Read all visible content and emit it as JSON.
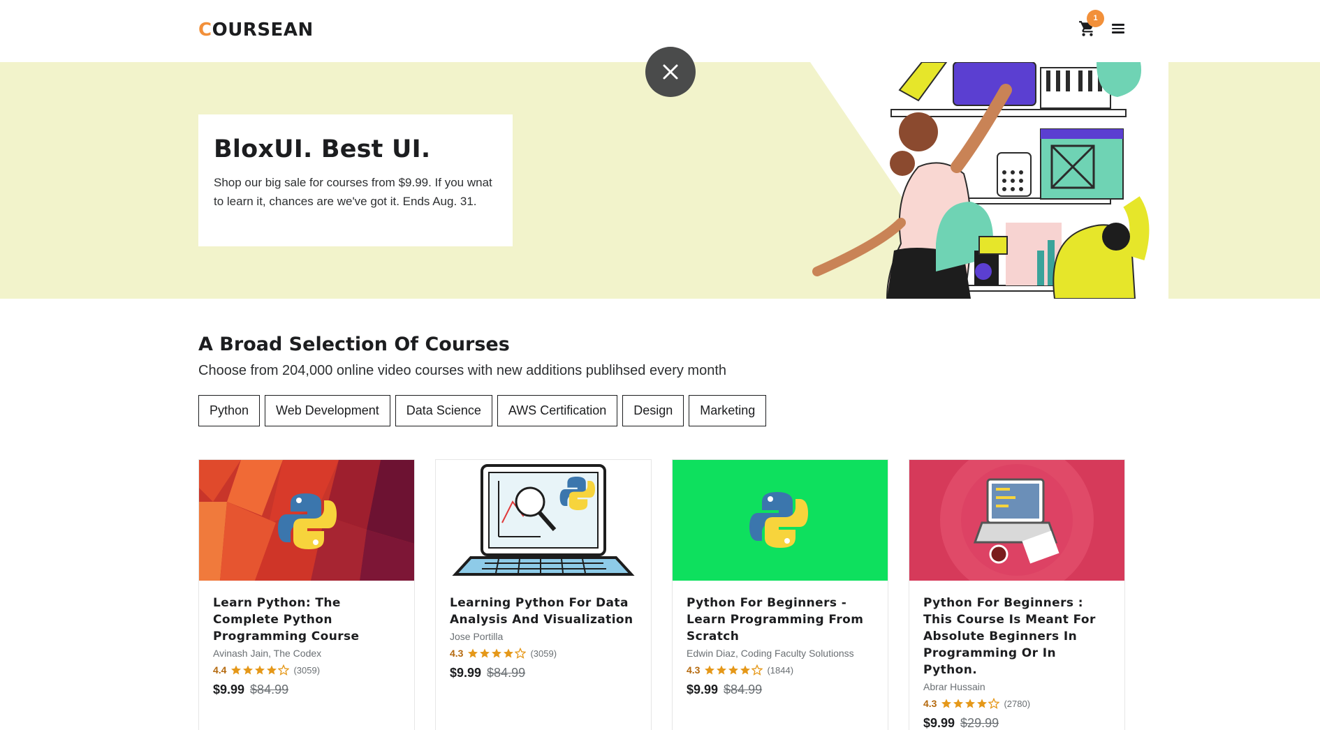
{
  "header": {
    "logo_first": "C",
    "logo_rest": "OURSEAN",
    "cart_count": "1",
    "cart_icon": "shopping-cart-icon",
    "menu_icon": "hamburger-menu-icon"
  },
  "hero": {
    "title": "BloxUI. Best UI.",
    "text": "Shop our big sale for courses from $9.99. If you wnat to learn it, chances are we've got it. Ends Aug. 31.",
    "close_icon": "close-icon"
  },
  "section": {
    "title": "A Broad Selection Of Courses",
    "subtitle": "Choose from 204,000 online video courses with new additions publihsed every month"
  },
  "categories": [
    "Python",
    "Web Development",
    "Data Science",
    "AWS Certification",
    "Design",
    "Marketing"
  ],
  "courses": [
    {
      "title": "Learn Python: The Complete Python Programming Course",
      "author": "Avinash Jain, The Codex",
      "rating": "4.4",
      "stars": 4.5,
      "count": "(3059)",
      "price": "$9.99",
      "old_price": "$84.99"
    },
    {
      "title": "Learning Python For Data Analysis And Visualization",
      "author": "Jose Portilla",
      "rating": "4.3",
      "stars": 4.5,
      "count": "(3059)",
      "price": "$9.99",
      "old_price": "$84.99"
    },
    {
      "title": "Python For Beginners - Learn Programming From Scratch",
      "author": "Edwin Diaz, Coding Faculty Solutionss",
      "rating": "4.3",
      "stars": 4.5,
      "count": "(1844)",
      "price": "$9.99",
      "old_price": "$84.99"
    },
    {
      "title": "Python For Beginners : This Course Is Meant For Absolute Beginners In Programming Or In Python.",
      "author": "Abrar Hussain",
      "rating": "4.3",
      "stars": 4.5,
      "count": "(2780)",
      "price": "$9.99",
      "old_price": "$29.99"
    }
  ],
  "colors": {
    "accent": "#f2903a",
    "hero_bg": "#f2f3cb",
    "rating": "#b4690e"
  }
}
